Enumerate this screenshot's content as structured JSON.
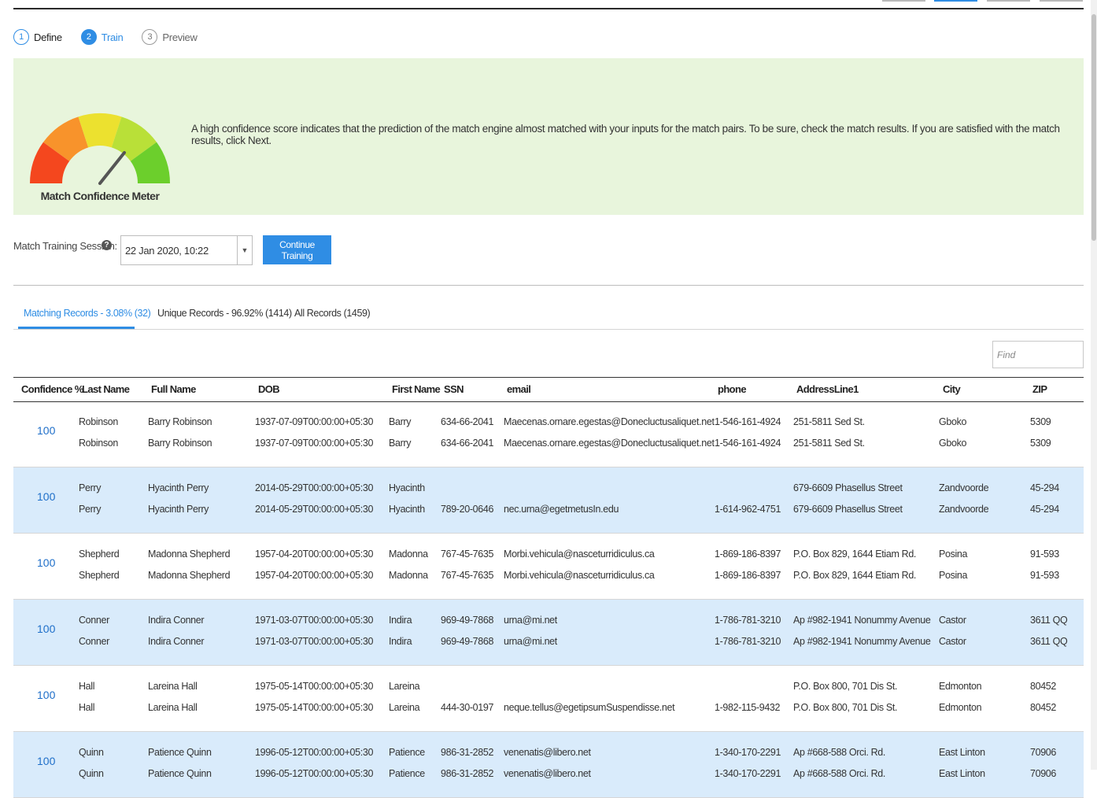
{
  "stepper": {
    "steps": [
      {
        "number": "1",
        "label": "Define"
      },
      {
        "number": "2",
        "label": "Train"
      },
      {
        "number": "3",
        "label": "Preview"
      }
    ]
  },
  "banner": {
    "meter_label": "Match Confidence Meter",
    "meter_colors": [
      "#f4471e",
      "#f8932b",
      "#ece12f",
      "#b9e038",
      "#6ccf2c"
    ],
    "message": "A high confidence score indicates that the prediction of the match engine almost matched with your inputs for the match pairs. To be sure, check the match results. If you are satisfied with the match results, click Next."
  },
  "session": {
    "label": "Match Training Session:",
    "value": "22 Jan 2020, 10:22",
    "continue_label": "Continue Training"
  },
  "tabs": [
    {
      "label": "Matching Records - 3.08% (32)"
    },
    {
      "label": "Unique Records - 96.92% (1414)"
    },
    {
      "label": "All Records (1459)"
    }
  ],
  "find": {
    "placeholder": "Find"
  },
  "table": {
    "headers": [
      "Confidence %",
      "Last Name",
      "Full Name",
      "DOB",
      "First Name",
      "SSN",
      "email",
      "phone",
      "AddressLine1",
      "City",
      "ZIP"
    ],
    "groups": [
      {
        "confidence": "100",
        "records": [
          {
            "last": "Robinson",
            "full": "Barry Robinson",
            "dob": "1937-07-09T00:00:00+05:30",
            "first": "Barry",
            "ssn": "634-66-2041",
            "email": "Maecenas.ornare.egestas@Donecluctusaliquet.net",
            "phone": "1-546-161-4924",
            "addr": "251-5811 Sed St.",
            "city": "Gboko",
            "zip": "5309"
          },
          {
            "last": "Robinson",
            "full": "Barry Robinson",
            "dob": "1937-07-09T00:00:00+05:30",
            "first": "Barry",
            "ssn": "634-66-2041",
            "email": "Maecenas.ornare.egestas@Donecluctusaliquet.net",
            "phone": "1-546-161-4924",
            "addr": "251-5811 Sed St.",
            "city": "Gboko",
            "zip": "5309"
          }
        ]
      },
      {
        "confidence": "100",
        "records": [
          {
            "last": "Perry",
            "full": "Hyacinth Perry",
            "dob": "2014-05-29T00:00:00+05:30",
            "first": "Hyacinth",
            "ssn": "",
            "email": "",
            "phone": "",
            "addr": "679-6609 Phasellus Street",
            "city": "Zandvoorde",
            "zip": "45-294"
          },
          {
            "last": "Perry",
            "full": "Hyacinth Perry",
            "dob": "2014-05-29T00:00:00+05:30",
            "first": "Hyacinth",
            "ssn": "789-20-0646",
            "email": "nec.urna@egetmetusIn.edu",
            "phone": "1-614-962-4751",
            "addr": "679-6609 Phasellus Street",
            "city": "Zandvoorde",
            "zip": "45-294"
          }
        ]
      },
      {
        "confidence": "100",
        "records": [
          {
            "last": "Shepherd",
            "full": "Madonna Shepherd",
            "dob": "1957-04-20T00:00:00+05:30",
            "first": "Madonna",
            "ssn": "767-45-7635",
            "email": "Morbi.vehicula@nasceturridiculus.ca",
            "phone": "1-869-186-8397",
            "addr": "P.O. Box 829, 1644 Etiam Rd.",
            "city": "Posina",
            "zip": "91-593"
          },
          {
            "last": "Shepherd",
            "full": "Madonna Shepherd",
            "dob": "1957-04-20T00:00:00+05:30",
            "first": "Madonna",
            "ssn": "767-45-7635",
            "email": "Morbi.vehicula@nasceturridiculus.ca",
            "phone": "1-869-186-8397",
            "addr": "P.O. Box 829, 1644 Etiam Rd.",
            "city": "Posina",
            "zip": "91-593"
          }
        ]
      },
      {
        "confidence": "100",
        "records": [
          {
            "last": "Conner",
            "full": "Indira Conner",
            "dob": "1971-03-07T00:00:00+05:30",
            "first": "Indira",
            "ssn": "969-49-7868",
            "email": "urna@mi.net",
            "phone": "1-786-781-3210",
            "addr": "Ap #982-1941 Nonummy Avenue",
            "city": "Castor",
            "zip": "3611 QQ"
          },
          {
            "last": "Conner",
            "full": "Indira Conner",
            "dob": "1971-03-07T00:00:00+05:30",
            "first": "Indira",
            "ssn": "969-49-7868",
            "email": "urna@mi.net",
            "phone": "1-786-781-3210",
            "addr": "Ap #982-1941 Nonummy Avenue",
            "city": "Castor",
            "zip": "3611 QQ"
          }
        ]
      },
      {
        "confidence": "100",
        "records": [
          {
            "last": "Hall",
            "full": "Lareina Hall",
            "dob": "1975-05-14T00:00:00+05:30",
            "first": "Lareina",
            "ssn": "",
            "email": "",
            "phone": "",
            "addr": "P.O. Box 800, 701 Dis St.",
            "city": "Edmonton",
            "zip": "80452"
          },
          {
            "last": "Hall",
            "full": "Lareina Hall",
            "dob": "1975-05-14T00:00:00+05:30",
            "first": "Lareina",
            "ssn": "444-30-0197",
            "email": "neque.tellus@egetipsumSuspendisse.net",
            "phone": "1-982-115-9432",
            "addr": "P.O. Box 800, 701 Dis St.",
            "city": "Edmonton",
            "zip": "80452"
          }
        ]
      },
      {
        "confidence": "100",
        "records": [
          {
            "last": "Quinn",
            "full": "Patience Quinn",
            "dob": "1996-05-12T00:00:00+05:30",
            "first": "Patience",
            "ssn": "986-31-2852",
            "email": "venenatis@libero.net",
            "phone": "1-340-170-2291",
            "addr": "Ap #668-588 Orci. Rd.",
            "city": "East Linton",
            "zip": "70906"
          },
          {
            "last": "Quinn",
            "full": "Patience Quinn",
            "dob": "1996-05-12T00:00:00+05:30",
            "first": "Patience",
            "ssn": "986-31-2852",
            "email": "venenatis@libero.net",
            "phone": "1-340-170-2291",
            "addr": "Ap #668-588 Orci. Rd.",
            "city": "East Linton",
            "zip": "70906"
          }
        ]
      }
    ]
  }
}
